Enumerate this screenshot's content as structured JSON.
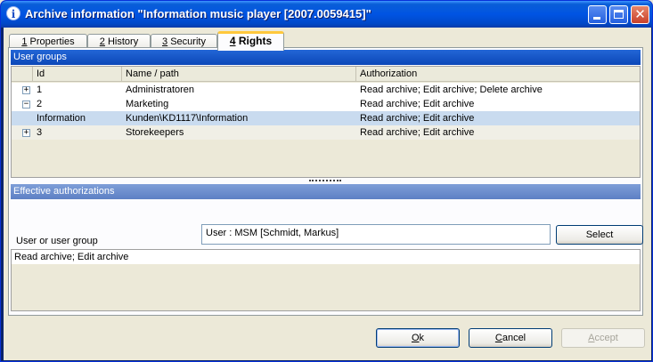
{
  "window": {
    "title": "Archive information \"Information music player [2007.0059415]\"",
    "icon": "info-icon"
  },
  "tabs": [
    {
      "key": "1",
      "label": " Properties"
    },
    {
      "key": "2",
      "label": " History"
    },
    {
      "key": "3",
      "label": " Security"
    },
    {
      "key": "4",
      "label": " Rights"
    }
  ],
  "user_groups": {
    "header": "User groups",
    "columns": [
      "Id",
      "Name / path",
      "Authorization"
    ],
    "rows": [
      {
        "expander": "+",
        "id": "1",
        "name": "Administratoren",
        "auth": "Read archive; Edit archive; Delete archive"
      },
      {
        "expander": "−",
        "id": "2",
        "name": "Marketing",
        "auth": "Read archive; Edit archive"
      },
      {
        "expander": "",
        "id": "Information",
        "name": "Kunden\\KD1117\\Information",
        "auth": "Read archive; Edit archive"
      },
      {
        "expander": "+",
        "id": "3",
        "name": "Storekeepers",
        "auth": "Read archive; Edit archive"
      }
    ]
  },
  "effective": {
    "header": "Effective authorizations",
    "label": "User or user group",
    "value": "User : MSM [Schmidt, Markus]",
    "select_label": "Select",
    "result": "Read archive; Edit archive"
  },
  "buttons": {
    "ok_key": "O",
    "ok_rest": "k",
    "cancel_pre": "",
    "cancel_key": "C",
    "cancel_rest": "ancel",
    "accept_key": "A",
    "accept_rest": "ccept"
  }
}
